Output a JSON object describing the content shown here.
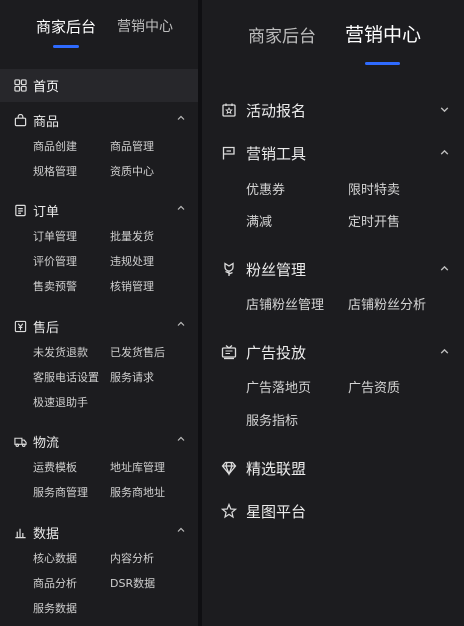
{
  "left_panel": {
    "tabs": [
      {
        "label": "商家后台",
        "active": true
      },
      {
        "label": "营销中心",
        "active": false
      }
    ],
    "home": {
      "label": "首页",
      "icon": "grid-icon"
    },
    "sections": [
      {
        "label": "商品",
        "icon": "bag-icon",
        "expanded": true,
        "rows": [
          [
            "商品创建",
            "商品管理"
          ],
          [
            "规格管理",
            "资质中心"
          ]
        ]
      },
      {
        "label": "订单",
        "icon": "document-icon",
        "expanded": true,
        "rows": [
          [
            "订单管理",
            "批量发货"
          ],
          [
            "评价管理",
            "违规处理"
          ],
          [
            "售卖预警",
            "核销管理"
          ]
        ]
      },
      {
        "label": "售后",
        "icon": "yen-box-icon",
        "expanded": true,
        "rows": [
          [
            "未发货退款",
            "已发货售后"
          ],
          [
            "客服电话设置",
            "服务请求"
          ],
          [
            "极速退助手"
          ]
        ]
      },
      {
        "label": "物流",
        "icon": "truck-icon",
        "expanded": true,
        "rows": [
          [
            "运费模板",
            "地址库管理"
          ],
          [
            "服务商管理",
            "服务商地址"
          ]
        ]
      },
      {
        "label": "数据",
        "icon": "bar-chart-icon",
        "expanded": true,
        "rows": [
          [
            "核心数据",
            "内容分析"
          ],
          [
            "商品分析",
            "DSR数据"
          ],
          [
            "服务数据"
          ]
        ]
      }
    ]
  },
  "right_panel": {
    "tabs": [
      {
        "label": "商家后台",
        "active": false
      },
      {
        "label": "营销中心",
        "active": true
      }
    ],
    "sections": [
      {
        "label": "活动报名",
        "icon": "calendar-star-icon",
        "expanded": false,
        "rows": []
      },
      {
        "label": "营销工具",
        "icon": "flag-icon",
        "expanded": true,
        "rows": [
          [
            "优惠券",
            "限时特卖"
          ],
          [
            "满减",
            "定时开售"
          ]
        ]
      },
      {
        "label": "粉丝管理",
        "icon": "flower-icon",
        "expanded": true,
        "rows": [
          [
            "店铺粉丝管理",
            "店铺粉丝分析"
          ]
        ]
      },
      {
        "label": "广告投放",
        "icon": "tv-icon",
        "expanded": true,
        "rows": [
          [
            "广告落地页",
            "广告资质"
          ],
          [
            "服务指标"
          ]
        ]
      },
      {
        "label": "精选联盟",
        "icon": "diamond-icon",
        "expanded": false,
        "rows": []
      },
      {
        "label": "星图平台",
        "icon": "star-map-icon",
        "expanded": false,
        "rows": []
      }
    ]
  },
  "colors": {
    "background": "#1c1c1f",
    "active_row": "#27272b",
    "accent": "#2f6bff",
    "text_primary": "#ffffff",
    "text_secondary": "#cfcfcf"
  }
}
